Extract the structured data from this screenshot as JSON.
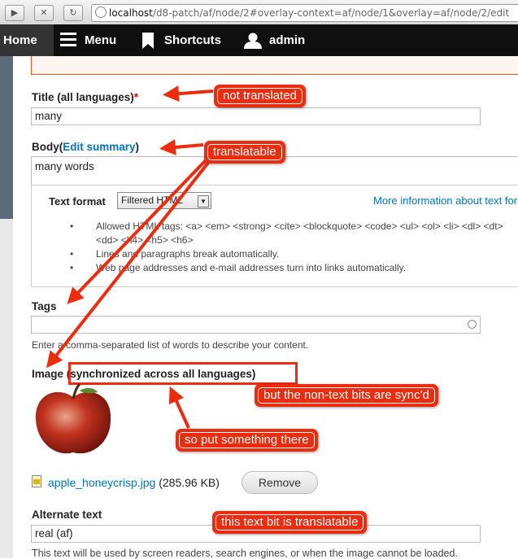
{
  "browser": {
    "url_host": "localhost",
    "url_path": "/d8-patch/af/node/2#overlay-context=af/node/1&overlay=af/node/2/edit",
    "back_glyph": "▶",
    "close_glyph": "✕",
    "reload_glyph": "↻"
  },
  "toolbar": {
    "home": "Home",
    "menu": "Menu",
    "shortcuts": "Shortcuts",
    "user": "admin"
  },
  "form": {
    "title_label": "Title (all languages)",
    "title_required": "*",
    "title_value": "many",
    "body_label": "Body",
    "body_paren_open": "(",
    "edit_summary": "Edit summary",
    "body_paren_close": ")",
    "body_value": "many words",
    "text_format_label": "Text format",
    "text_format_value": "Filtered HTML",
    "format_more_info": "More information about text formats",
    "format_tips": [
      "Allowed HTML tags: <a> <em> <strong> <cite> <blockquote> <code> <ul> <ol> <li> <dl> <dt> <dd> <h4> <h5> <h6>",
      "Lines and paragraphs break automatically.",
      "Web page addresses and e-mail addresses turn into links automatically."
    ],
    "tags_label": "Tags",
    "tags_value": "",
    "tags_help": "Enter a comma-separated list of words to describe your content.",
    "image_label": "Image (synchronized across all languages)",
    "file_name": "apple_honeycrisp.jpg",
    "file_size": "(285.96 KB)",
    "remove_button": "Remove",
    "alt_label": "Alternate text",
    "alt_value": "real (af)",
    "alt_help": "This text will be used by screen readers, search engines, or when the image cannot be loaded."
  },
  "annotations": {
    "not_translated": "not translated",
    "translatable": "translatable",
    "sync": "but the non-text bits are sync'd",
    "put_something": "so put something there",
    "alt_translatable": "this text bit is translatable"
  },
  "colors": {
    "callout_red": "#ec2c0e",
    "toolbar_bg": "#0f0f0f",
    "link_blue": "#0074bd"
  }
}
